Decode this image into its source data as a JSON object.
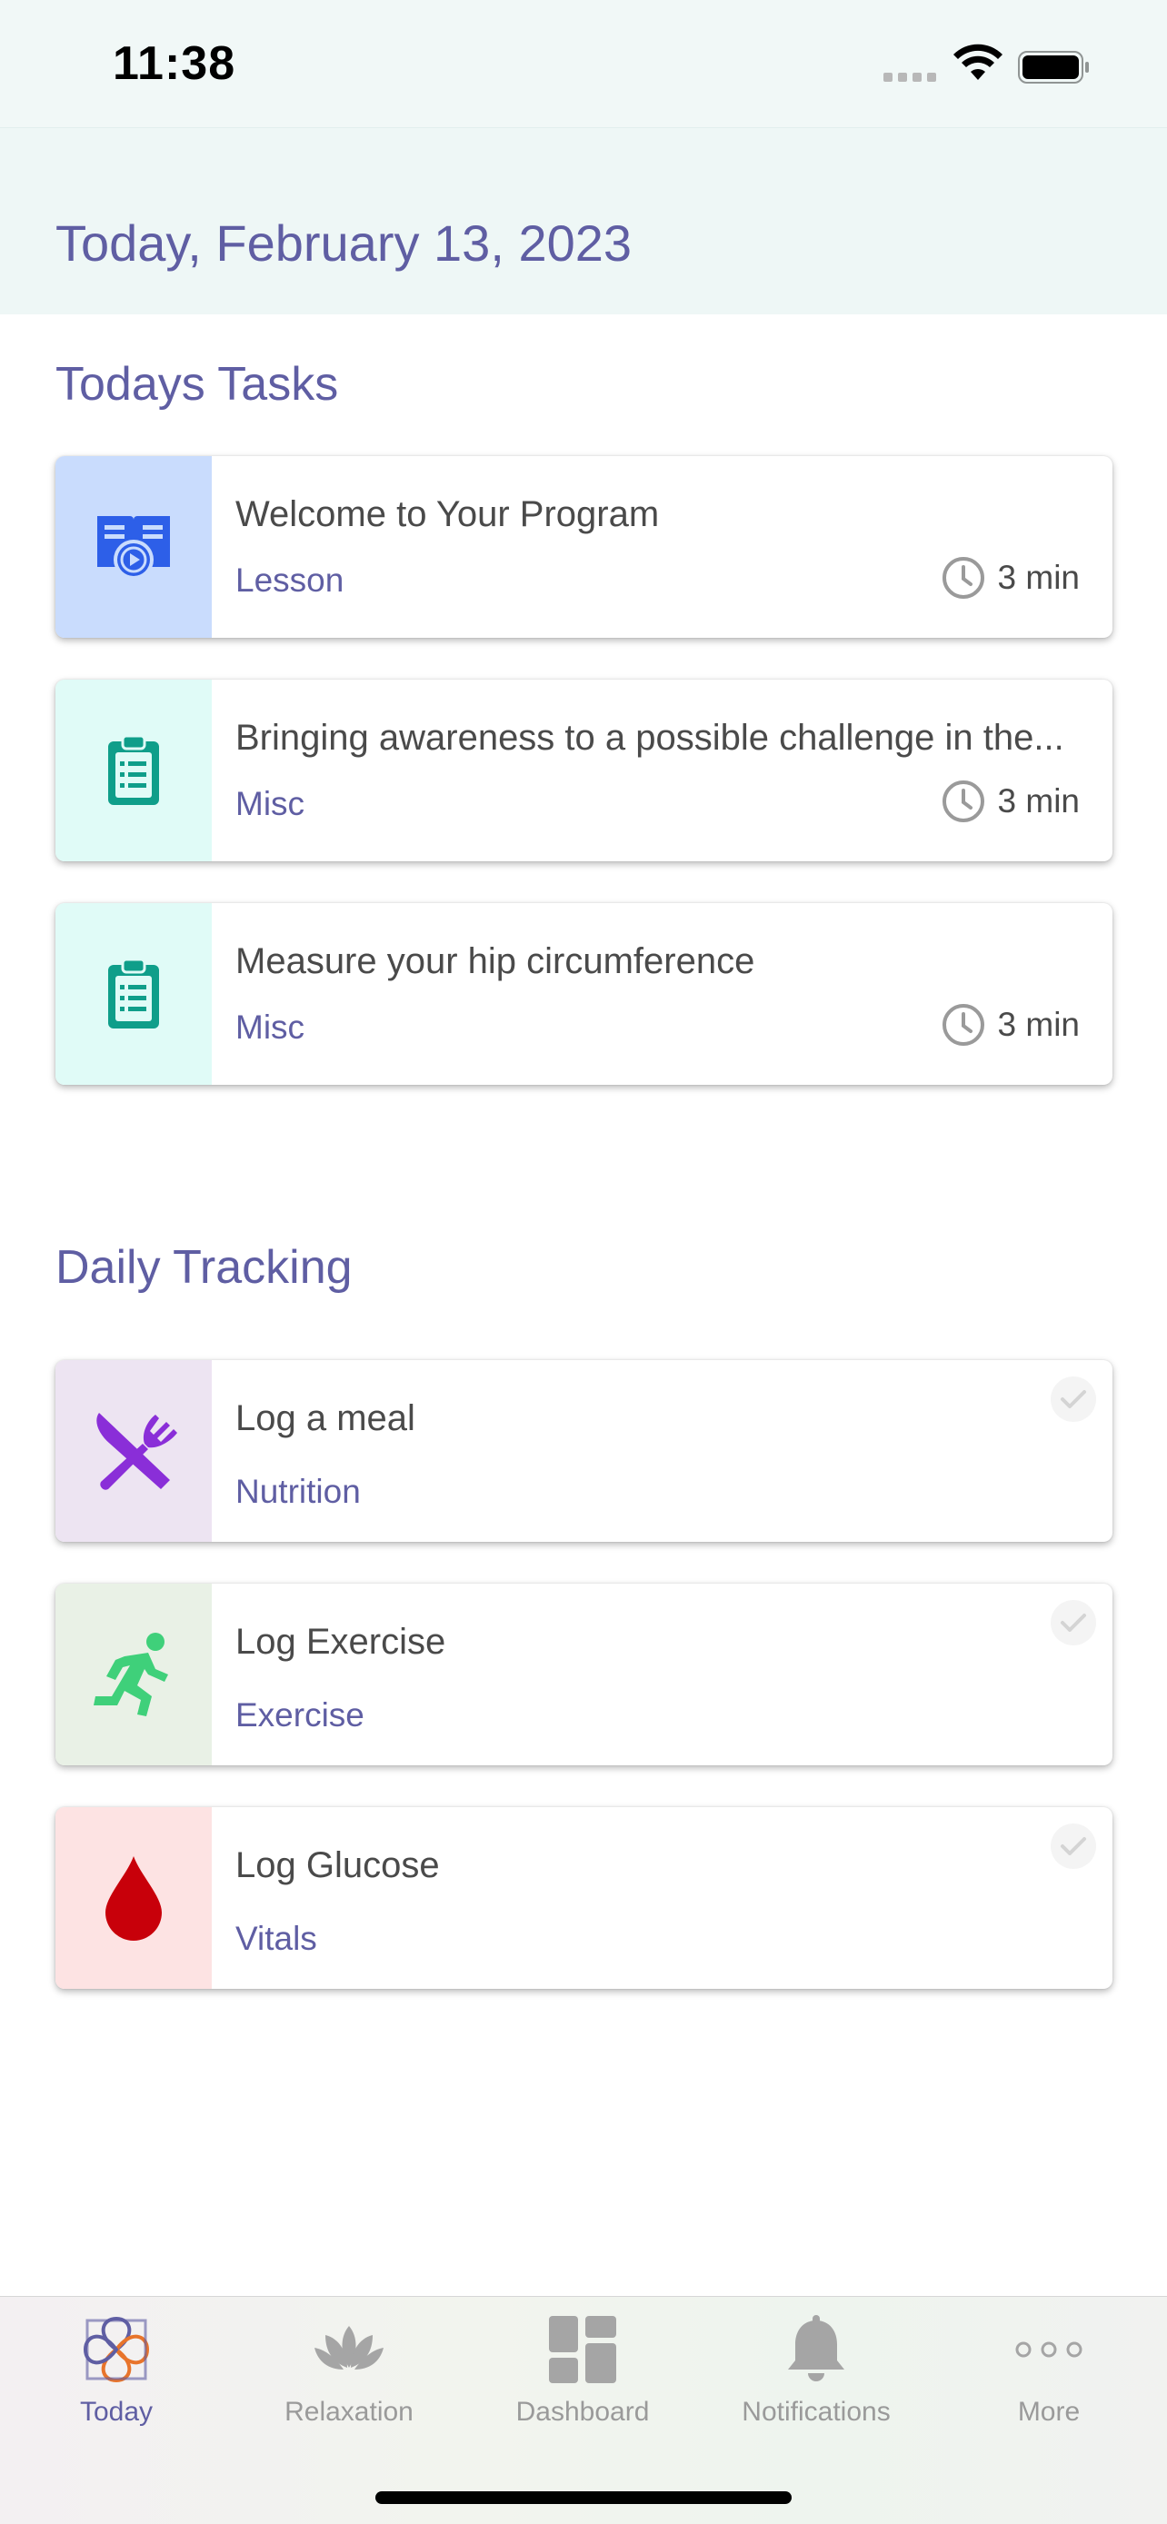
{
  "status_bar": {
    "time": "11:38"
  },
  "header": {
    "date": "Today, February 13, 2023"
  },
  "tasks_section": {
    "title": "Todays Tasks",
    "items": [
      {
        "title": "Welcome to Your Program",
        "category": "Lesson",
        "duration": "3 min",
        "icon": "lesson-video-icon",
        "icon_bg": "#c9dcfd"
      },
      {
        "title": "Bringing awareness to a possible challenge in the...",
        "category": "Misc",
        "duration": "3 min",
        "icon": "clipboard-icon",
        "icon_bg": "#e0fbf7"
      },
      {
        "title": "Measure your hip circumference",
        "category": "Misc",
        "duration": "3 min",
        "icon": "clipboard-icon",
        "icon_bg": "#e0fbf7"
      }
    ]
  },
  "tracking_section": {
    "title": "Daily Tracking",
    "items": [
      {
        "title": "Log a meal",
        "category": "Nutrition",
        "icon": "utensils-icon",
        "icon_bg": "#ede4f2"
      },
      {
        "title": "Log Exercise",
        "category": "Exercise",
        "icon": "running-icon",
        "icon_bg": "#e9f1e6"
      },
      {
        "title": "Log Glucose",
        "category": "Vitals",
        "icon": "blood-drop-icon",
        "icon_bg": "#fde3e3"
      }
    ]
  },
  "tab_bar": {
    "tabs": [
      {
        "label": "Today",
        "icon": "today-flower-icon",
        "active": true
      },
      {
        "label": "Relaxation",
        "icon": "lotus-icon",
        "active": false
      },
      {
        "label": "Dashboard",
        "icon": "dashboard-grid-icon",
        "active": false
      },
      {
        "label": "Notifications",
        "icon": "bell-icon",
        "active": false
      },
      {
        "label": "More",
        "icon": "more-dots-icon",
        "active": false
      }
    ]
  },
  "colors": {
    "accent": "#5f5ea3",
    "header_bg": "#eef7f6",
    "clipboard": "#0f9e8a",
    "lesson": "#2d5fe8",
    "meal": "#8a2ed8",
    "exercise": "#3fd07a",
    "glucose": "#c8000a"
  }
}
